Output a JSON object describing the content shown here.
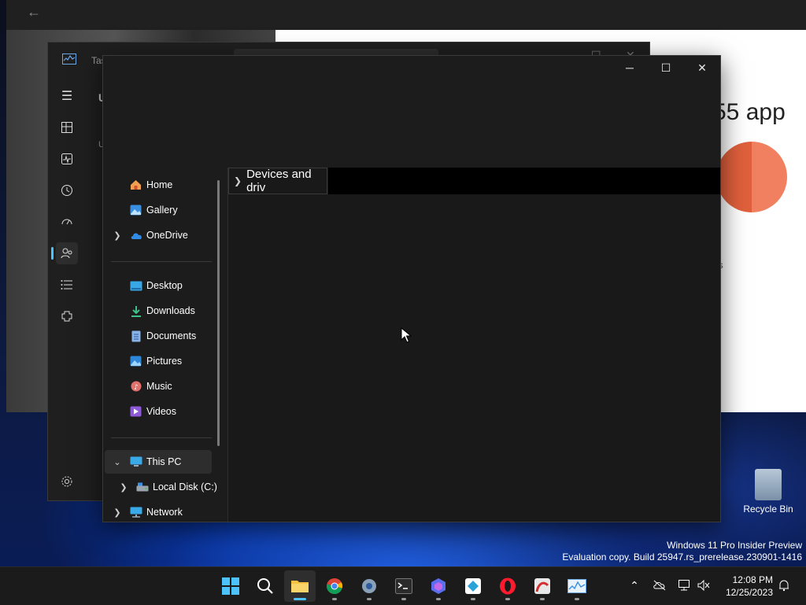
{
  "back_browser": {
    "headline": "55 app",
    "small_text": "os"
  },
  "task_manager": {
    "title": "Tas",
    "side_letter_1": "U",
    "side_letter_2": "U",
    "rail_icons": [
      "hamburger-icon",
      "processes-icon",
      "performance-icon",
      "app-history-icon",
      "startup-apps-icon",
      "users-icon",
      "details-icon",
      "services-icon",
      "settings-icon"
    ]
  },
  "explorer": {
    "controls": {
      "minimize": "─",
      "maximize": "☐",
      "close": "✕"
    },
    "nav": {
      "quick": [
        {
          "label": "Home",
          "icon": "home-icon"
        },
        {
          "label": "Gallery",
          "icon": "gallery-icon"
        },
        {
          "label": "OneDrive",
          "icon": "onedrive-icon",
          "expandable": true
        }
      ],
      "pinned": [
        {
          "label": "Desktop",
          "icon": "desktop-folder-icon"
        },
        {
          "label": "Downloads",
          "icon": "downloads-icon"
        },
        {
          "label": "Documents",
          "icon": "documents-icon"
        },
        {
          "label": "Pictures",
          "icon": "pictures-icon"
        },
        {
          "label": "Music",
          "icon": "music-icon"
        },
        {
          "label": "Videos",
          "icon": "videos-icon"
        }
      ],
      "this_pc": {
        "label": "This PC",
        "expanded": true,
        "selected": true
      },
      "local_disk": {
        "label": "Local Disk (C:)"
      },
      "network": {
        "label": "Network"
      }
    },
    "group_header": "Devices and driv"
  },
  "desktop": {
    "recycle_bin": "Recycle Bin",
    "watermark_line1": "Windows 11 Pro Insider Preview",
    "watermark_line2": "Evaluation copy. Build 25947.rs_prerelease.230901-1416"
  },
  "taskbar": {
    "apps": [
      "start-icon",
      "search-icon",
      "file-explorer-icon",
      "chrome-icon",
      "settings-app-icon",
      "terminal-icon",
      "copilot-icon",
      "app-icon",
      "opera-icon",
      "pdf-icon",
      "task-manager-icon"
    ],
    "active_app": "file-explorer-icon",
    "time": "12:08 PM",
    "date": "12/25/2023"
  },
  "colors": {
    "accent": "#4cc2ff",
    "explorer_bg": "#191919",
    "taskbar_bg": "#1b1b1b"
  }
}
